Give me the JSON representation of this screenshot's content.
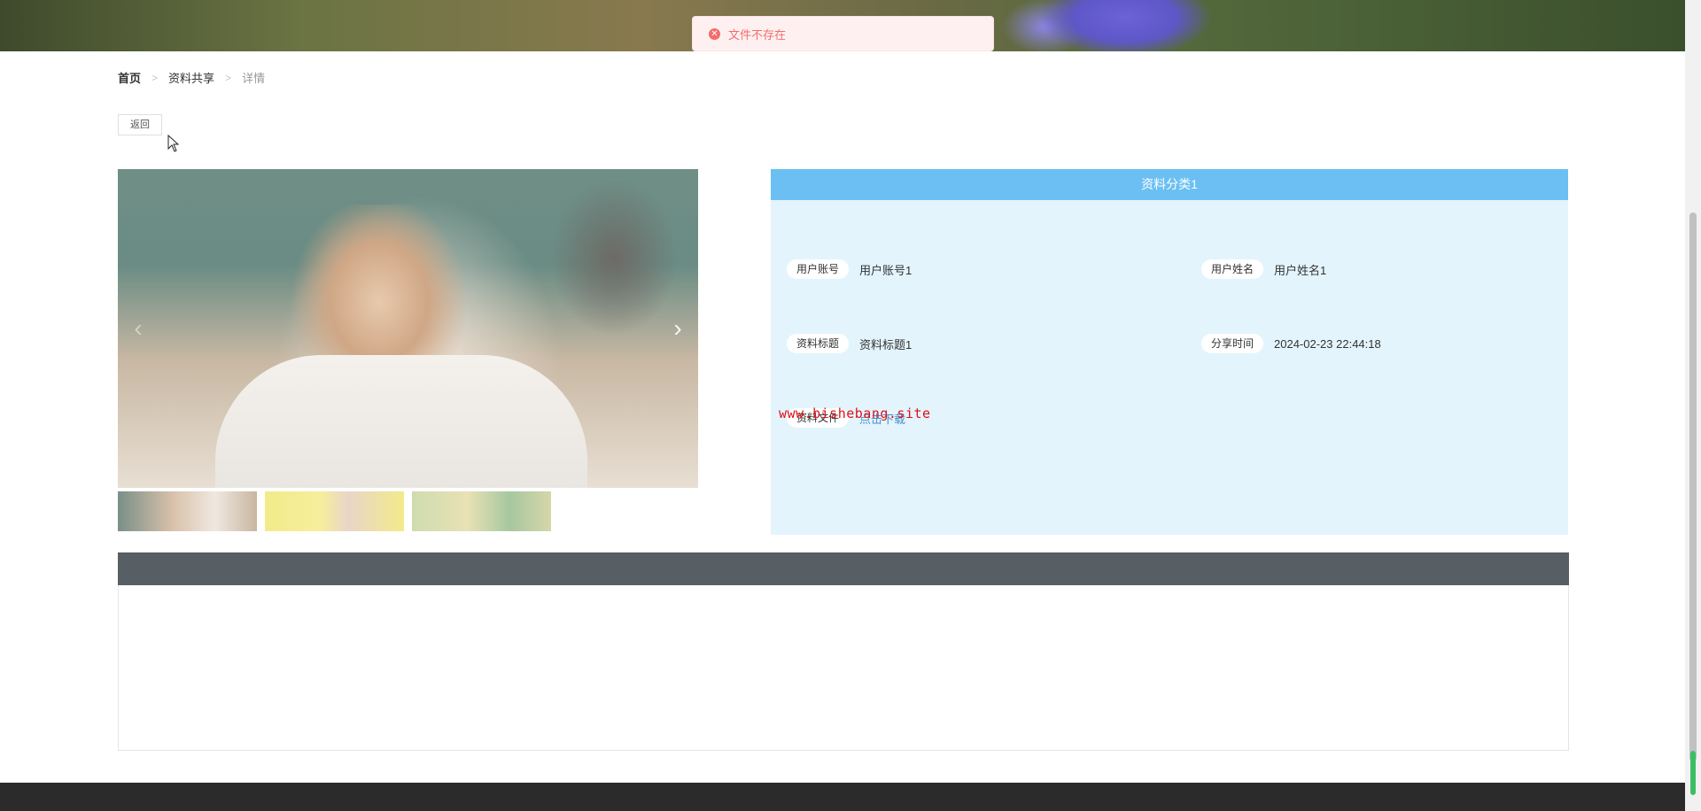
{
  "toast": {
    "message": "文件不存在",
    "icon": "error-circle-icon",
    "color": "#f56c6c"
  },
  "breadcrumb": {
    "home": "首页",
    "section": "资料共享",
    "current": "详情",
    "separator": ">"
  },
  "back_button": {
    "label": "返回"
  },
  "carousel": {
    "prev_icon": "‹",
    "next_icon": "›",
    "thumbnails": [
      "thumbnail-1",
      "thumbnail-2",
      "thumbnail-3"
    ],
    "active_index": 0
  },
  "info": {
    "header": "资料分类1",
    "header_color": "#6bbff3",
    "fields": [
      {
        "label": "用户账号",
        "value": "用户账号1"
      },
      {
        "label": "用户姓名",
        "value": "用户姓名1"
      },
      {
        "label": "资料标题",
        "value": "资料标题1"
      },
      {
        "label": "分享时间",
        "value": "2024-02-23 22:44:18"
      },
      {
        "label": "资料文件",
        "value": "点击下载"
      }
    ]
  },
  "watermark": "www.bishebang.site",
  "colors": {
    "panel_bg": "#e3f4fd",
    "comment_bar": "#575e64",
    "footer": "#2b2b2b"
  }
}
